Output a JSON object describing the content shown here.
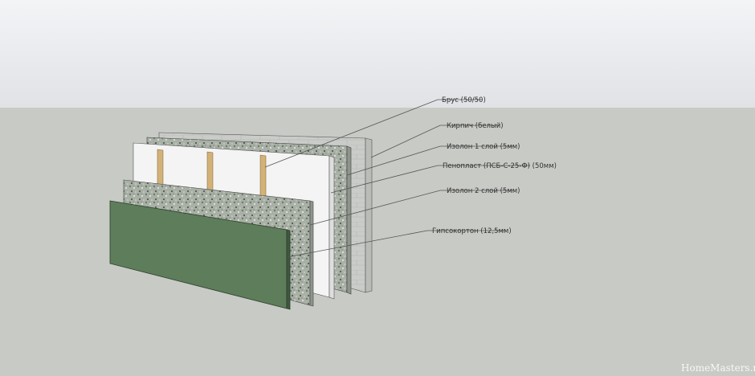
{
  "diagram": {
    "layers": [
      {
        "id": "brick",
        "label": "Кирпич (белый)"
      },
      {
        "id": "izolon-1",
        "label": "Изолон 1 слой (5мм)"
      },
      {
        "id": "penoplast",
        "label": "Пенопласт (ПСБ-С-25-Ф) (50мм)"
      },
      {
        "id": "brus",
        "label": "Брус (50/50)"
      },
      {
        "id": "izolon-2",
        "label": "Изолон 2 слой (5мм)"
      },
      {
        "id": "gypsum",
        "label": "Гипсокортон (12,5мм)"
      }
    ]
  },
  "watermark": "HomeMasters.ru",
  "colors": {
    "sky_top": "#f3f4f6",
    "sky_bottom": "#e0e2e6",
    "ground": "#c8cac5",
    "brick": "#c9ccc8",
    "izolon": "#a7aea4",
    "foam": "#f4f4f4",
    "timber": "#d3b277",
    "gypsum": "#5d7d5b"
  }
}
